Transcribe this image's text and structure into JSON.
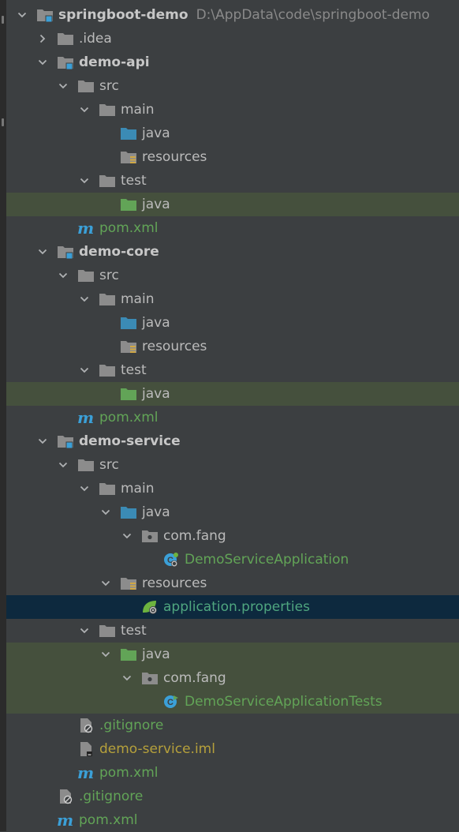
{
  "project": {
    "name": "springboot-demo",
    "path": "D:\\AppData\\code\\springboot-demo",
    "idea": ".idea",
    "modules": [
      {
        "name": "demo-api",
        "src": "src",
        "main": "main",
        "java": "java",
        "resources": "resources",
        "test": "test",
        "test_java": "java",
        "pom": "pom.xml"
      },
      {
        "name": "demo-core",
        "src": "src",
        "main": "main",
        "java": "java",
        "resources": "resources",
        "test": "test",
        "test_java": "java",
        "pom": "pom.xml"
      },
      {
        "name": "demo-service",
        "src": "src",
        "main": "main",
        "java": "java",
        "package": "com.fang",
        "app_class": "DemoServiceApplication",
        "resources": "resources",
        "properties": "application.properties",
        "test": "test",
        "test_java": "java",
        "test_package": "com.fang",
        "test_class": "DemoServiceApplicationTests",
        "gitignore": ".gitignore",
        "iml": "demo-service.iml",
        "pom": "pom.xml"
      }
    ],
    "root_gitignore": ".gitignore",
    "root_pom": "pom.xml",
    "maven_glyph": "m"
  },
  "colors": {
    "background": "#3c3f41",
    "text": "#bbbbbb",
    "test_root_highlight": "#45503d",
    "selection": "#0d293e",
    "source_folder": "#3b8bb5",
    "test_folder": "#62a457",
    "plain_folder": "#8c8c8c",
    "vcs_added_green": "#62a457",
    "ignored_yellow": "#b5a03b"
  }
}
